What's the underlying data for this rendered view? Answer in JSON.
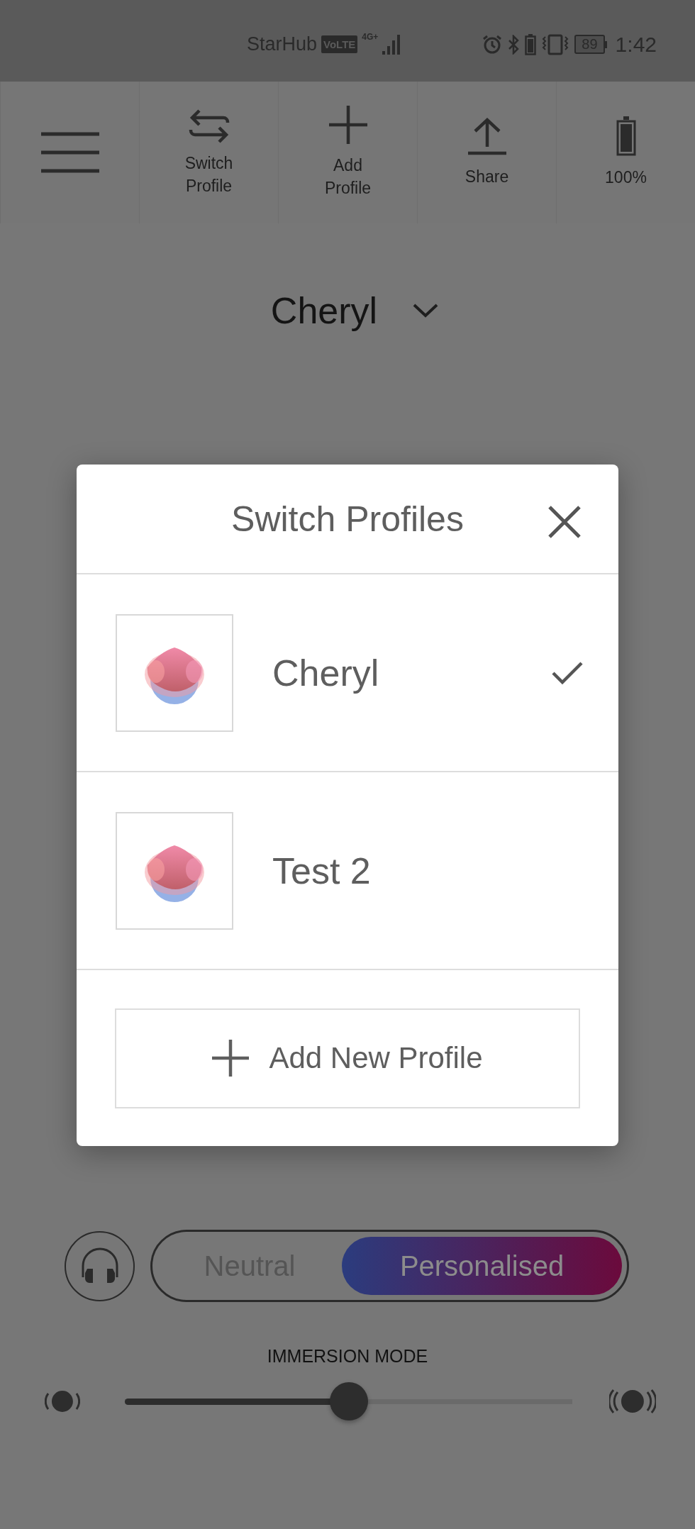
{
  "status_bar": {
    "carrier": "StarHub",
    "volte": "VoLTE",
    "network": "4G+",
    "battery": "89",
    "time": "1:42"
  },
  "toolbar": [
    {
      "kind": "menu"
    },
    {
      "kind": "switch",
      "label": "Switch Profile"
    },
    {
      "kind": "add",
      "label": "Add Profile"
    },
    {
      "kind": "share",
      "label": "Share"
    },
    {
      "kind": "battery",
      "label": "100%"
    }
  ],
  "profile_title": "Cheryl",
  "dialog": {
    "title": "Switch Profiles",
    "profiles": [
      {
        "name": "Cheryl",
        "selected": true
      },
      {
        "name": "Test 2",
        "selected": false
      }
    ],
    "add_button": "Add New Profile"
  },
  "mode_toggle": [
    {
      "label": "Neutral",
      "selected": false
    },
    {
      "label": "Personalised",
      "selected": true
    }
  ],
  "immersion": {
    "label": "IMMERSION MODE",
    "level": 0.5
  }
}
